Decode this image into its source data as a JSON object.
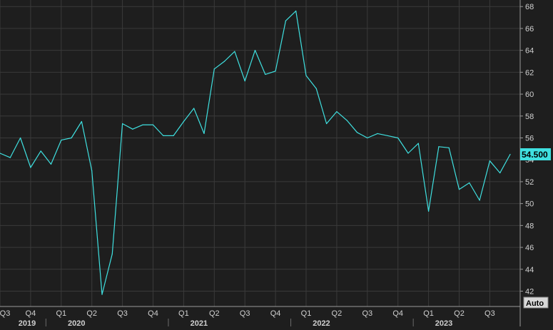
{
  "chart_data": {
    "type": "line",
    "title": "",
    "xlabel": "",
    "ylabel": "",
    "ylim": [
      40.6,
      68.6
    ],
    "y_ticks": [
      42,
      44,
      46,
      48,
      50,
      52,
      54,
      56,
      58,
      60,
      62,
      64,
      66,
      68
    ],
    "grid": true,
    "legend": "none",
    "quarter_labels": [
      "Q3",
      "Q4",
      "Q1",
      "Q2",
      "Q3",
      "Q4",
      "Q1",
      "Q2",
      "Q3",
      "Q4",
      "Q1",
      "Q2",
      "Q3",
      "Q4",
      "Q1",
      "Q2",
      "Q3"
    ],
    "year_labels": [
      "2019",
      "2020",
      "2021",
      "2022",
      "2023"
    ],
    "last_value_label": "54.500",
    "auto_button": "Auto",
    "x": [
      "2019-07",
      "2019-08",
      "2019-09",
      "2019-10",
      "2019-11",
      "2019-12",
      "2020-01",
      "2020-02",
      "2020-03",
      "2020-04",
      "2020-05",
      "2020-06",
      "2020-07",
      "2020-08",
      "2020-09",
      "2020-10",
      "2020-11",
      "2020-12",
      "2021-01",
      "2021-02",
      "2021-03",
      "2021-04",
      "2021-05",
      "2021-06",
      "2021-07",
      "2021-08",
      "2021-09",
      "2021-10",
      "2021-11",
      "2021-12",
      "2022-01",
      "2022-02",
      "2022-03",
      "2022-04",
      "2022-05",
      "2022-06",
      "2022-07",
      "2022-08",
      "2022-09",
      "2022-10",
      "2022-11",
      "2022-12",
      "2023-01",
      "2023-02",
      "2023-03",
      "2023-04",
      "2023-05",
      "2023-06",
      "2023-07",
      "2023-08",
      "2023-09"
    ],
    "series": [
      {
        "values": [
          54.6,
          54.2,
          56.0,
          53.3,
          54.8,
          53.6,
          55.8,
          56.0,
          57.5,
          53.0,
          41.7,
          45.4,
          57.3,
          56.8,
          57.2,
          57.2,
          56.2,
          56.2,
          57.5,
          58.7,
          56.4,
          62.3,
          63.0,
          63.9,
          61.2,
          64.0,
          61.8,
          62.1,
          66.7,
          67.6,
          61.7,
          60.5,
          57.3,
          58.4,
          57.6,
          56.5,
          56.0,
          56.4,
          56.2,
          56.0,
          54.6,
          55.5,
          49.3,
          55.2,
          55.1,
          51.3,
          51.9,
          50.3,
          53.9,
          52.8,
          54.5
        ],
        "color": "#3fe0e0"
      }
    ],
    "colors": {
      "background": "#1e1e1e",
      "grid": "#3a3a3a",
      "line": "#3fe0e0",
      "text": "#d0d0d0",
      "highlight_bg": "#3fe0e0",
      "highlight_text": "#000000",
      "button_bg": "#d8d8d8",
      "button_text": "#000000"
    }
  }
}
